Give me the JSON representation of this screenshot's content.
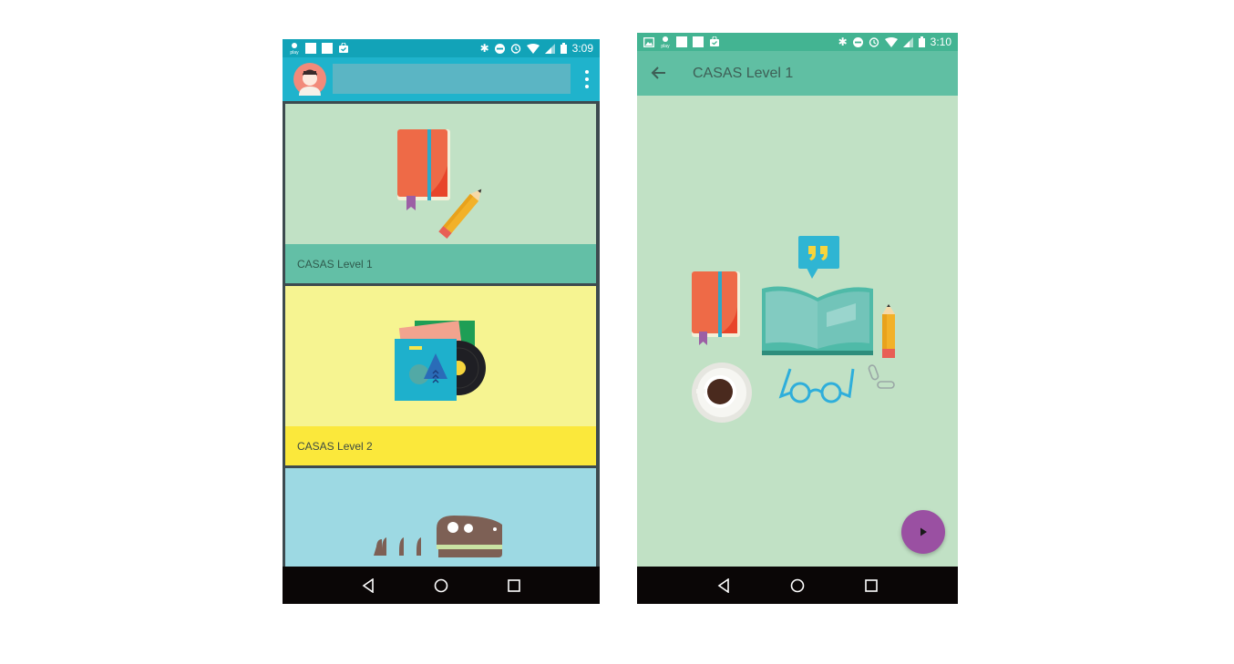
{
  "left_screen": {
    "status_bar": {
      "time": "3:09",
      "left_icons": [
        "play-store-notification-icon",
        "notification-square-icon",
        "notification-square-icon",
        "shopping-bag-icon"
      ],
      "right_icons": [
        "bluetooth-icon",
        "do-not-disturb-icon",
        "alarm-icon",
        "wifi-icon",
        "signal-icon",
        "battery-icon"
      ]
    },
    "toolbar": {
      "avatar_icon": "user-avatar-icon",
      "search_value": "",
      "overflow_icon": "more-vert-icon"
    },
    "cards": [
      {
        "title": "CASAS Level 1",
        "illustration": "book-and-pencil-icon",
        "background": "#c1e1c5",
        "caption_background": "#63bfa6"
      },
      {
        "title": "CASAS Level 2",
        "illustration": "vinyl-record-icon",
        "background": "#f6f491",
        "caption_background": "#fbe83b"
      },
      {
        "title": "",
        "illustration": "dinosaur-skull-icon",
        "background": "#9dd9e3"
      }
    ],
    "nav_bar": [
      "back-triangle-icon",
      "home-circle-icon",
      "recents-square-icon"
    ]
  },
  "right_screen": {
    "status_bar": {
      "time": "3:10",
      "left_icons": [
        "image-notification-icon",
        "play-store-notification-icon",
        "notification-square-icon",
        "notification-square-icon",
        "shopping-bag-icon"
      ],
      "right_icons": [
        "bluetooth-icon",
        "do-not-disturb-icon",
        "alarm-icon",
        "wifi-icon",
        "signal-icon",
        "battery-icon"
      ]
    },
    "toolbar": {
      "back_icon": "arrow-back-icon",
      "title": "CASAS Level 1"
    },
    "hero_illustration": [
      "book-icon",
      "quote-bubble-icon",
      "open-book-icon",
      "pencil-icon",
      "coffee-cup-icon",
      "glasses-icon",
      "paperclip-icon"
    ],
    "fab_icon": "play-icon",
    "nav_bar": [
      "back-triangle-icon",
      "home-circle-icon",
      "recents-square-icon"
    ]
  },
  "colors": {
    "left_status": "#12a3b8",
    "left_toolbar": "#1fb3cc",
    "right_status": "#43b492",
    "right_toolbar": "#60bfa3",
    "fab": "#9a50a2"
  }
}
